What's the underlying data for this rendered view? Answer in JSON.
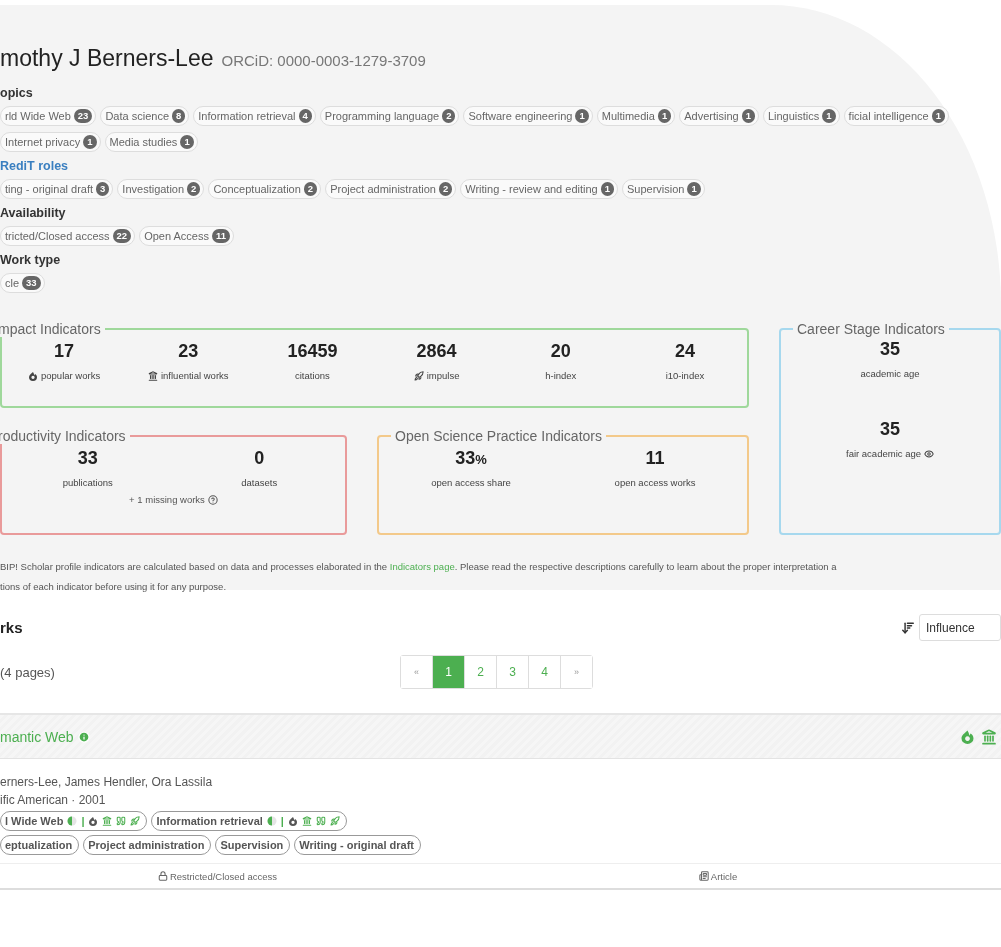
{
  "profile": {
    "name": "mothy J Berners-Lee",
    "orcid": "ORCiD: 0000-0003-1279-3709"
  },
  "facets": [
    {
      "title": "opics",
      "kind": "plain",
      "chips": [
        {
          "label": "rld Wide Web",
          "count": "23"
        },
        {
          "label": "Data science",
          "count": "8"
        },
        {
          "label": "Information retrieval",
          "count": "4"
        },
        {
          "label": "Programming language",
          "count": "2"
        },
        {
          "label": "Software engineering",
          "count": "1"
        },
        {
          "label": "Multimedia",
          "count": "1"
        },
        {
          "label": "Advertising",
          "count": "1"
        },
        {
          "label": "Linguistics",
          "count": "1"
        },
        {
          "label": "ficial intelligence",
          "count": "1"
        },
        {
          "label": "Internet privacy",
          "count": "1"
        },
        {
          "label": "Media studies",
          "count": "1"
        }
      ]
    },
    {
      "title": "RediT roles",
      "kind": "link",
      "chips": [
        {
          "label": "ting - original draft",
          "count": "3"
        },
        {
          "label": "Investigation",
          "count": "2"
        },
        {
          "label": "Conceptualization",
          "count": "2"
        },
        {
          "label": "Project administration",
          "count": "2"
        },
        {
          "label": "Writing - review and editing",
          "count": "1"
        },
        {
          "label": "Supervision",
          "count": "1"
        }
      ]
    },
    {
      "title": "Availability",
      "kind": "plain",
      "chips": [
        {
          "label": "tricted/Closed access",
          "count": "22"
        },
        {
          "label": "Open Access",
          "count": "11"
        }
      ]
    },
    {
      "title": "Work type",
      "kind": "plain",
      "chips": [
        {
          "label": "cle",
          "count": "33"
        }
      ]
    }
  ],
  "indicator_groups": [
    {
      "legend": "mpact Indicators",
      "color": "#9fd89b",
      "stats": [
        {
          "value": "17",
          "label": "popular works",
          "kind": "popular"
        },
        {
          "value": "23",
          "label": "influential works",
          "kind": "influential"
        },
        {
          "value": "16459",
          "label": "citations",
          "kind": "plain"
        },
        {
          "value": "2864",
          "label": "impulse",
          "kind": "impulse"
        },
        {
          "value": "20",
          "label": "h-index",
          "kind": "plain"
        },
        {
          "value": "24",
          "label": "i10-index",
          "kind": "plain"
        }
      ]
    },
    {
      "legend": "Career Stage Indicators",
      "color": "#a6d8ee",
      "stats": [
        {
          "value": "35",
          "label": "academic age",
          "kind": "plain"
        },
        {
          "value": "35",
          "label": "fair academic age",
          "kind": "eye"
        }
      ]
    },
    {
      "legend": "roductivity Indicators",
      "color": "#e99a9a",
      "note": "+ 1 missing works",
      "stats": [
        {
          "value": "33",
          "label": "publications",
          "kind": "plain"
        },
        {
          "value": "0",
          "label": "datasets",
          "kind": "plain"
        }
      ]
    },
    {
      "legend": "Open Science Practice Indicators",
      "color": "#f3c98a",
      "stats": [
        {
          "value": "33",
          "unit": "%",
          "label": "open access share",
          "kind": "plain"
        },
        {
          "value": "11",
          "label": "open access works",
          "kind": "plain"
        }
      ]
    }
  ],
  "note": {
    "line1_before": "BIP! Scholar profile indicators are calculated based on data and processes elaborated in the",
    "link": "Indicators page",
    "line1_after": ". Please read the respective descriptions carefully to learn about the proper interpretation a",
    "line2": "tions of each indicator before using it for any purpose."
  },
  "works": {
    "heading": "rks",
    "sort": {
      "value": "Influence"
    },
    "pages_note": "(4 pages)",
    "pagination": [
      {
        "label": "«",
        "selected": false
      },
      {
        "label": "1",
        "selected": true
      },
      {
        "label": "2",
        "selected": false
      },
      {
        "label": "3",
        "selected": false
      },
      {
        "label": "4",
        "selected": false
      },
      {
        "label": "»",
        "selected": false
      }
    ],
    "items": [
      {
        "title": "mantic Web",
        "authors": "erners-Lee, James Hendler, Ora Lassila",
        "venue": "ific American · 2001",
        "topics": [
          {
            "label": "l Wide Web",
            "separator": "|"
          },
          {
            "label": "Information retrieval",
            "separator": "|"
          }
        ],
        "roles": [
          "eptualization",
          "Project administration",
          "Supervision",
          "Writing - original draft"
        ],
        "access": "Restricted/Closed access",
        "type": "Article"
      }
    ]
  }
}
